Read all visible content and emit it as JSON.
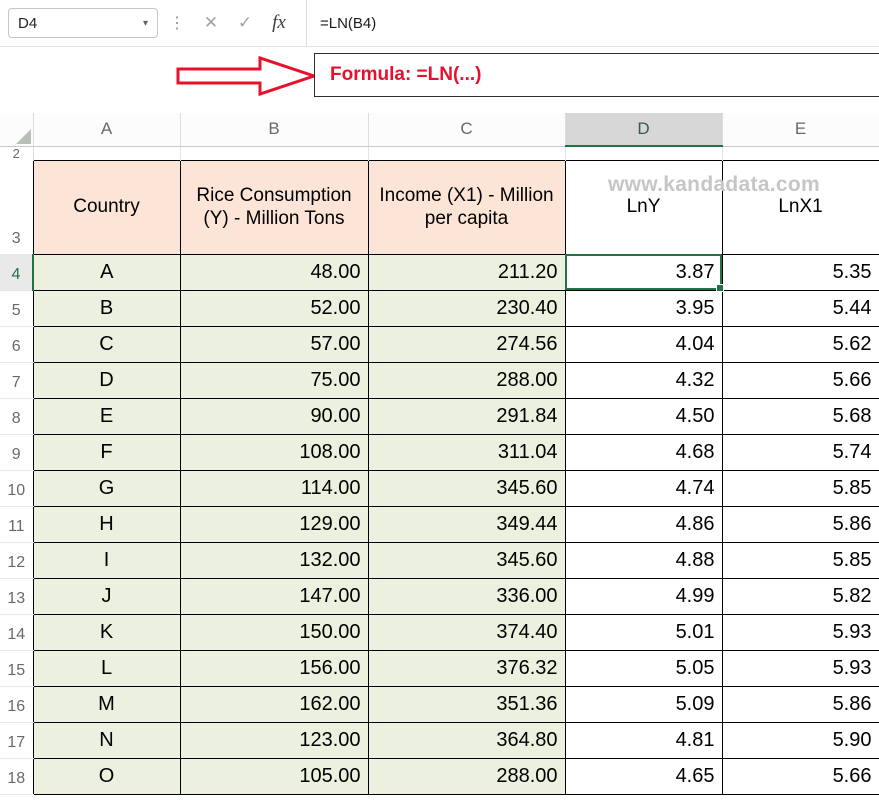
{
  "name_box": {
    "value": "D4"
  },
  "formula_bar": {
    "value": "=LN(B4)"
  },
  "icons": {
    "name_box_dropdown": "▾",
    "menu_dots": "⋮",
    "cancel": "✕",
    "enter": "✓",
    "insert_function": "fx"
  },
  "annotation": {
    "label": "Formula: =LN(...)"
  },
  "watermark": "www.kandadata.com",
  "colors": {
    "accent_green": "#217346",
    "annotation_red": "#e8112d",
    "header_peach": "#fce4d6",
    "data_green": "#ebf1de",
    "watermark_gray": "#c6c6c6"
  },
  "grid": {
    "column_headers": [
      "A",
      "B",
      "C",
      "D",
      "E"
    ],
    "sliver_row_number": "2",
    "header_row_number": "3",
    "headers": [
      "Country",
      "Rice Consumption (Y) - Million Tons",
      "Income (X1) - Million per capita",
      "LnY",
      "LnX1"
    ],
    "rows": [
      {
        "n": "4",
        "cells": [
          "A",
          "48.00",
          "211.20",
          "3.87",
          "5.35"
        ]
      },
      {
        "n": "5",
        "cells": [
          "B",
          "52.00",
          "230.40",
          "3.95",
          "5.44"
        ]
      },
      {
        "n": "6",
        "cells": [
          "C",
          "57.00",
          "274.56",
          "4.04",
          "5.62"
        ]
      },
      {
        "n": "7",
        "cells": [
          "D",
          "75.00",
          "288.00",
          "4.32",
          "5.66"
        ]
      },
      {
        "n": "8",
        "cells": [
          "E",
          "90.00",
          "291.84",
          "4.50",
          "5.68"
        ]
      },
      {
        "n": "9",
        "cells": [
          "F",
          "108.00",
          "311.04",
          "4.68",
          "5.74"
        ]
      },
      {
        "n": "10",
        "cells": [
          "G",
          "114.00",
          "345.60",
          "4.74",
          "5.85"
        ]
      },
      {
        "n": "11",
        "cells": [
          "H",
          "129.00",
          "349.44",
          "4.86",
          "5.86"
        ]
      },
      {
        "n": "12",
        "cells": [
          "I",
          "132.00",
          "345.60",
          "4.88",
          "5.85"
        ]
      },
      {
        "n": "13",
        "cells": [
          "J",
          "147.00",
          "336.00",
          "4.99",
          "5.82"
        ]
      },
      {
        "n": "14",
        "cells": [
          "K",
          "150.00",
          "374.40",
          "5.01",
          "5.93"
        ]
      },
      {
        "n": "15",
        "cells": [
          "L",
          "156.00",
          "376.32",
          "5.05",
          "5.93"
        ]
      },
      {
        "n": "16",
        "cells": [
          "M",
          "162.00",
          "351.36",
          "5.09",
          "5.86"
        ]
      },
      {
        "n": "17",
        "cells": [
          "N",
          "123.00",
          "364.80",
          "4.81",
          "5.90"
        ]
      },
      {
        "n": "18",
        "cells": [
          "O",
          "105.00",
          "288.00",
          "4.65",
          "5.66"
        ]
      }
    ],
    "selection": {
      "cell": "D4",
      "row": "4",
      "col": "D"
    }
  }
}
